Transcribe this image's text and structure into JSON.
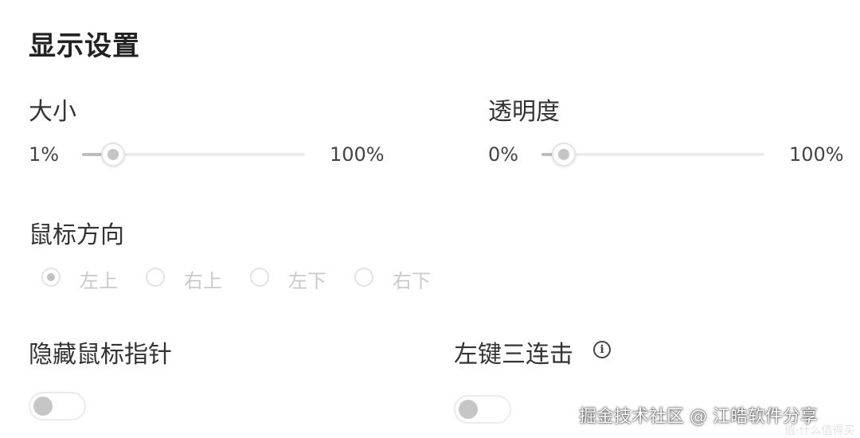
{
  "page": {
    "title": "显示设置"
  },
  "size": {
    "label": "大小",
    "min_label": "1%",
    "max_label": "100%",
    "value_fraction": 0.14
  },
  "opacity": {
    "label": "透明度",
    "min_label": "0%",
    "max_label": "100%",
    "value_fraction": 0.1
  },
  "cursor_direction": {
    "label": "鼠标方向",
    "selected": "左上",
    "options": [
      "左上",
      "右上",
      "左下",
      "右下"
    ]
  },
  "hide_cursor": {
    "label": "隐藏鼠标指针",
    "enabled": false
  },
  "triple_click": {
    "label": "左键三连击",
    "enabled": false,
    "info_icon": "info-icon"
  },
  "watermark": {
    "text": "掘金技术社区 @ 江皓软件分享",
    "subtext": "值·什么值得买"
  },
  "colors": {
    "track": "#ececec",
    "fill": "#bdbdbd",
    "thumb_dot": "#c4c4c4",
    "disabled_text": "#c9c9c9"
  }
}
